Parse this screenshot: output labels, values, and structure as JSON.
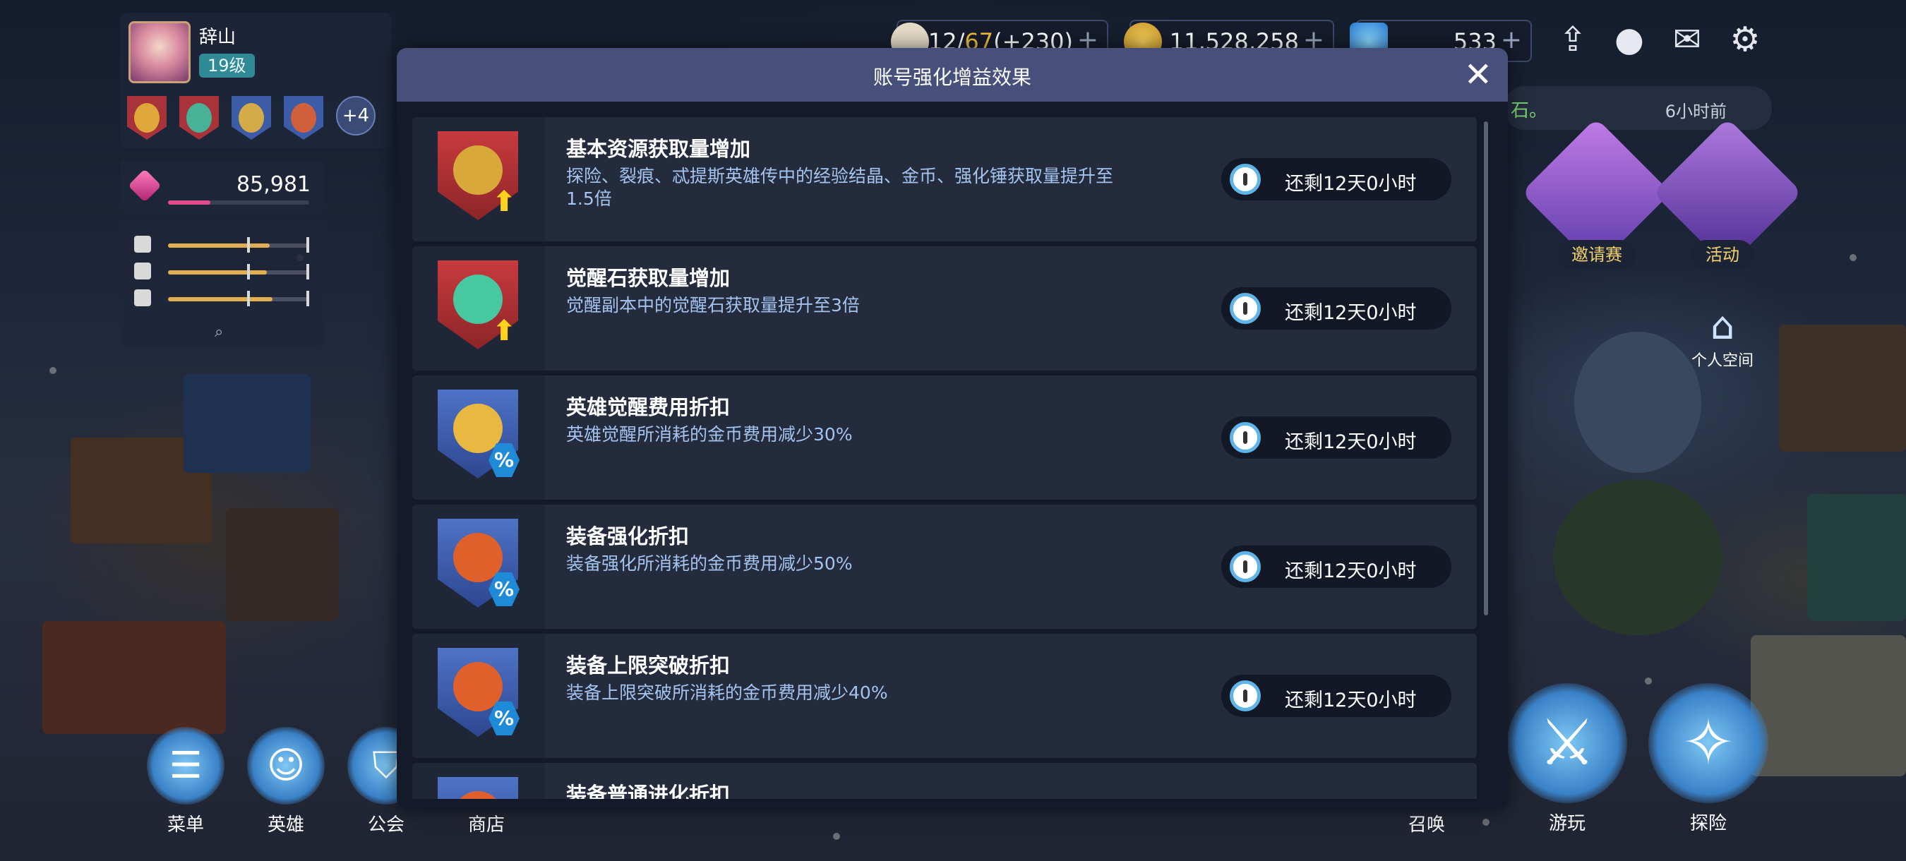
{
  "player": {
    "name": "辞山",
    "level": "19级",
    "buff_more": "+4"
  },
  "gems": {
    "value": "85,981",
    "progress": 0.3
  },
  "stats": [
    {
      "icon": "fork-knife-icon",
      "fill": 0.72
    },
    {
      "icon": "cup-icon",
      "fill": 0.7
    },
    {
      "icon": "dice-icon",
      "fill": 0.74
    }
  ],
  "resources": {
    "stamina_current": "12/",
    "stamina_max": "67",
    "stamina_bonus": "(+230)",
    "gold": "11,528,258",
    "diamonds": "533",
    "plus": "+"
  },
  "notice": {
    "partial_text": "石。",
    "time": "6小时前"
  },
  "side": {
    "invite_label": "邀请赛",
    "event_label": "活动",
    "home_label": "个人空间"
  },
  "nav": {
    "menu": "菜单",
    "heroes": "英雄",
    "guild": "公会",
    "shop": "商店",
    "summon": "召唤",
    "play": "游玩",
    "explore": "探险"
  },
  "modal": {
    "title": "账号强化增益效果",
    "close": "✕",
    "effects": [
      {
        "title": "基本资源获取量增加",
        "desc": "探险、裂痕、忒提斯英雄传中的经验结晶、金币、强化锤获取量提升至1.5倍",
        "timer": "还剩12天0小时",
        "shield": "red",
        "corner": "arrow"
      },
      {
        "title": "觉醒石获取量增加",
        "desc": "觉醒副本中的觉醒石获取量提升至3倍",
        "timer": "还剩12天0小时",
        "shield": "red",
        "corner": "arrow"
      },
      {
        "title": "英雄觉醒费用折扣",
        "desc": "英雄觉醒所消耗的金币费用减少30%",
        "timer": "还剩12天0小时",
        "shield": "blue",
        "corner": "pct"
      },
      {
        "title": "装备强化折扣",
        "desc": "装备强化所消耗的金币费用减少50%",
        "timer": "还剩12天0小时",
        "shield": "blue",
        "corner": "pct"
      },
      {
        "title": "装备上限突破折扣",
        "desc": "装备上限突破所消耗的金币费用减少40%",
        "timer": "还剩12天0小时",
        "shield": "blue",
        "corner": "pct"
      },
      {
        "title": "装备普通进化折扣",
        "desc": "",
        "timer": "",
        "shield": "blue",
        "corner": "pct"
      }
    ]
  },
  "colors": {
    "modal_header": "#47507a",
    "timer_accent": "#5fb4e8",
    "gold_highlight": "#f0c040"
  }
}
